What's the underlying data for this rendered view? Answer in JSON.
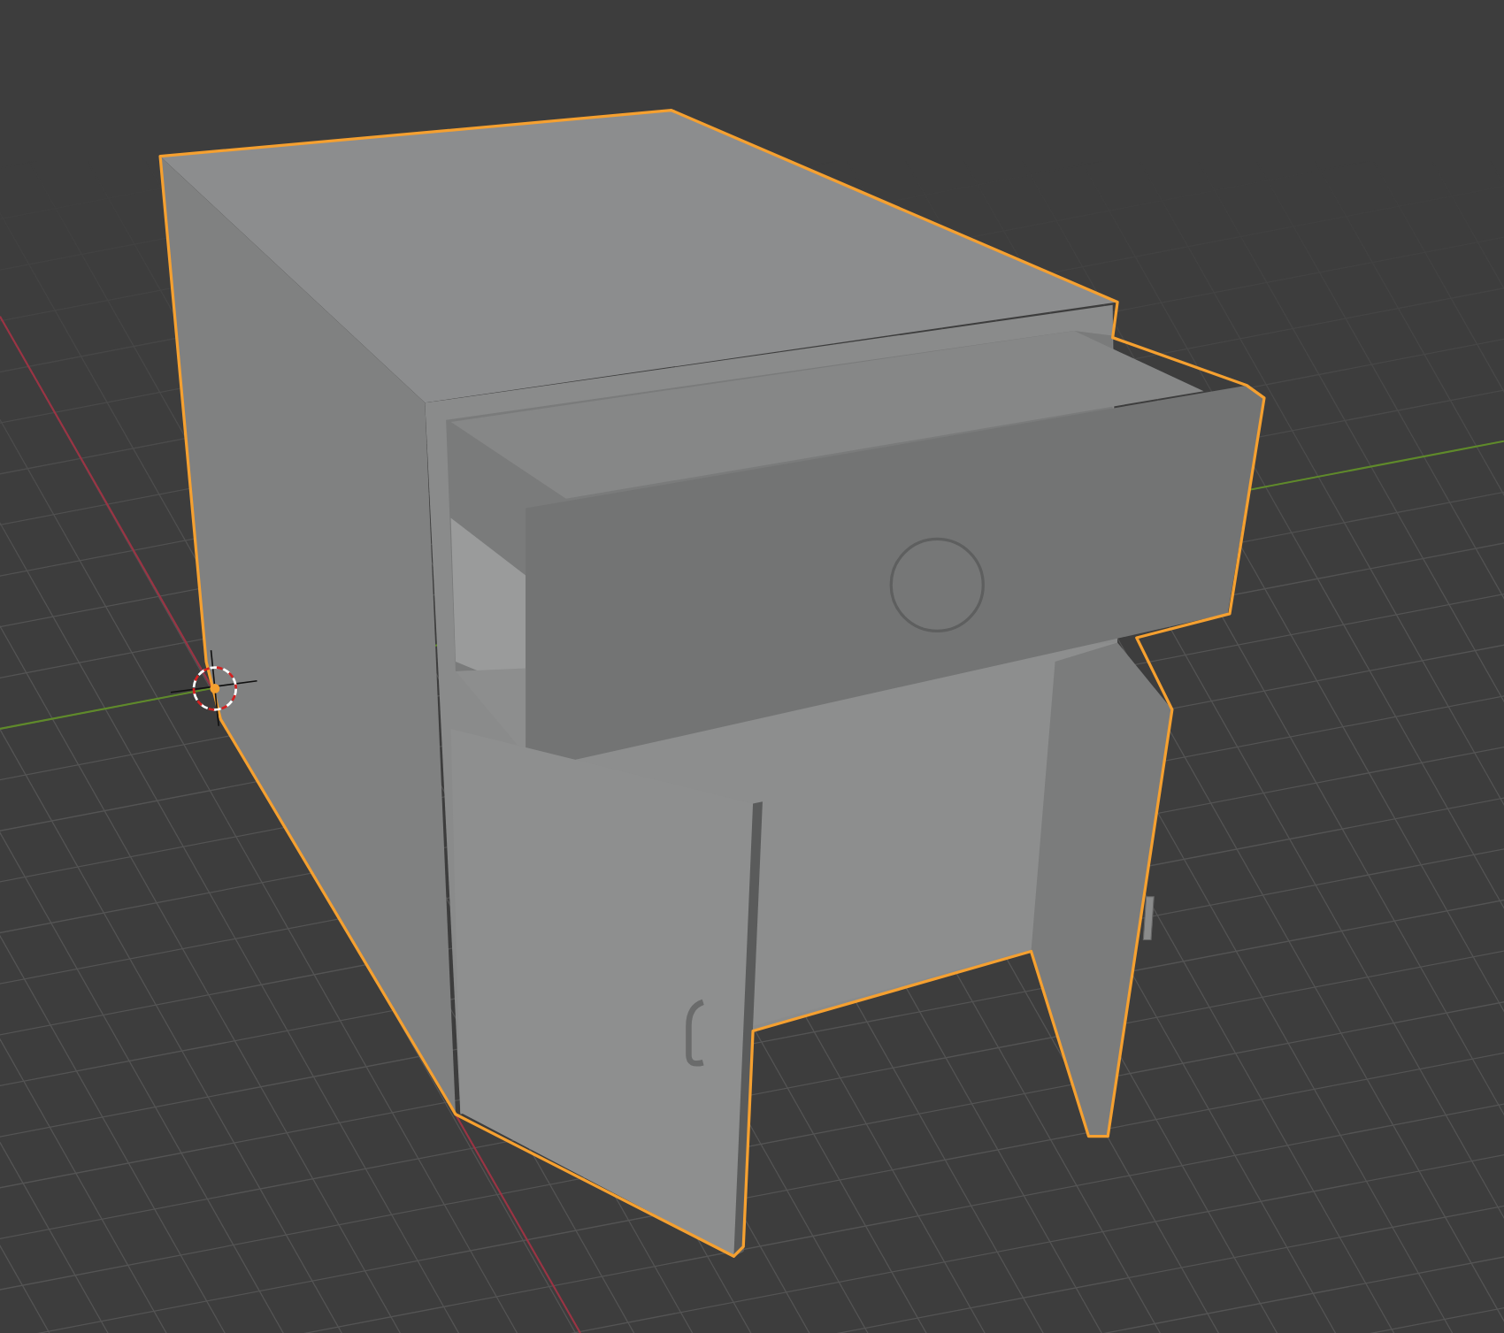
{
  "viewport": {
    "object": {
      "selected": true
    }
  }
}
